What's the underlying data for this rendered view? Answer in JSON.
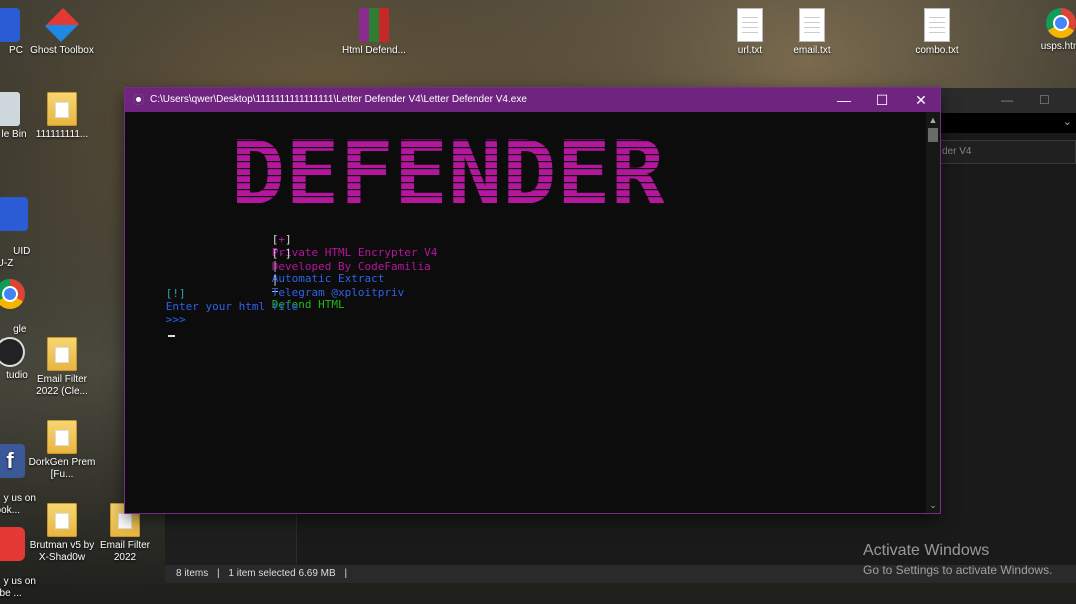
{
  "desktop": {
    "icons": [
      {
        "label": "PC"
      },
      {
        "label": "Ghost Toolbox"
      },
      {
        "label": "Html Defend..."
      },
      {
        "label": "url.txt"
      },
      {
        "label": "email.txt"
      },
      {
        "label": "combo.txt"
      },
      {
        "label": "usps.htm"
      },
      {
        "label": "le Bin"
      },
      {
        "label": "111111111..."
      },
      {
        "label": "UID\nU-Z"
      },
      {
        "label": "gle\nome"
      },
      {
        "label": "tudio"
      },
      {
        "label": "Email Filter 2022 (Cle..."
      },
      {
        "label": "y us on\nbook..."
      },
      {
        "label": "DorkGen Prem [Fu..."
      },
      {
        "label": "y us on\nTube ..."
      },
      {
        "label": "Brutman v5 by X-Shad0w"
      },
      {
        "label": "Email Filter 2022"
      }
    ]
  },
  "explorer": {
    "address_fragment": "der V4",
    "status_items": "8 items",
    "status_selected": "1 item selected  6.69 MB"
  },
  "console": {
    "title": "C:\\Users\\qwer\\Desktop\\1111111111111111\\Letter Defender V4\\Letter Defender V4.exe",
    "banner_text": "DEFENDER",
    "line1": {
      "bracket_open": "[",
      "mark": "+",
      "bracket_close": "]",
      "part1": "Private HTML Encrypter V4",
      "sep": "|",
      "part2": "Automatic Extract",
      "plus": "+",
      "part3": "Defend HTML"
    },
    "line2": {
      "bracket_open": "[",
      "mark": "-",
      "bracket_close": "]",
      "part1": "Developed By CodeFamilia",
      "sep": "|",
      "part2": "Telegram @xploitpriv"
    },
    "prompt": {
      "tag": "[!]",
      "text": "Enter your html file",
      "arrows": ">>>"
    },
    "buttons": {
      "minimize": "—",
      "maximize": "☐",
      "close": "✕"
    }
  },
  "watermark": {
    "line1": "Activate Windows",
    "line2": "Go to Settings to activate Windows."
  },
  "colors": {
    "title_bar": "#6f2580",
    "banner": "#b5169e",
    "magenta_text": "#b5169e",
    "blue_text": "#2f62e8",
    "green_text": "#1fb81f",
    "white_text": "#dddddd"
  }
}
